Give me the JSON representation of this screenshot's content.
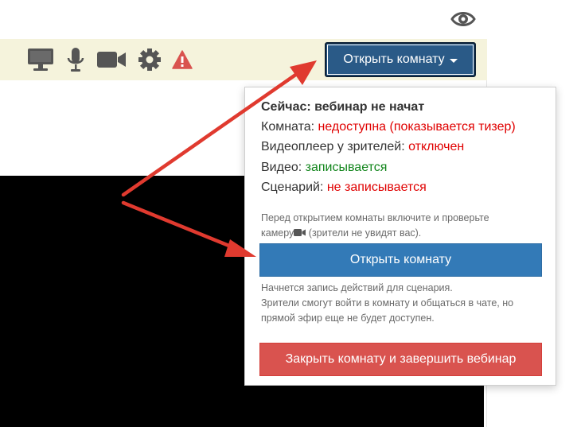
{
  "toolbar": {
    "icons": [
      "screen-share-icon",
      "microphone-icon",
      "camera-icon",
      "settings-gear-icon",
      "warning-icon"
    ],
    "open_room_dropdown_label": "Открыть комнату",
    "colors": {
      "background": "#f5f3dc",
      "icons": "#555555",
      "warning": "#d9534f",
      "dropdown": "#2a5a87"
    }
  },
  "header": {
    "icons": [
      "eye-icon"
    ]
  },
  "popover": {
    "title": "Сейчас: вебинар не начат",
    "status": [
      {
        "label": "Комната: ",
        "value": "недоступна (показывается тизер)",
        "color": "red"
      },
      {
        "label": "Видеоплеер у зрителей: ",
        "value": "отключен",
        "color": "red"
      },
      {
        "label": "Видео: ",
        "value": "записывается",
        "color": "green"
      },
      {
        "label": "Сценарий: ",
        "value": "не записывается",
        "color": "red"
      }
    ],
    "pre_note_1": "Перед открытием комнаты включите и проверьте",
    "pre_note_2a": "камеру",
    "pre_note_2b": " (зрители не увидят вас).",
    "open_button_label": "Открыть комнату",
    "post_note_1": "Начнется запись действий для сценария.",
    "post_note_2": "Зрители смогут войти в комнату и общаться в чате, но",
    "post_note_3": "прямой эфир еще не будет доступен.",
    "close_button_label": "Закрыть комнату и завершить вебинар",
    "colors": {
      "red": "#e00000",
      "green": "#11851b",
      "primary": "#337ab7",
      "danger": "#d9534f"
    }
  },
  "annotations": {
    "arrow_color": "#e03a2f"
  }
}
